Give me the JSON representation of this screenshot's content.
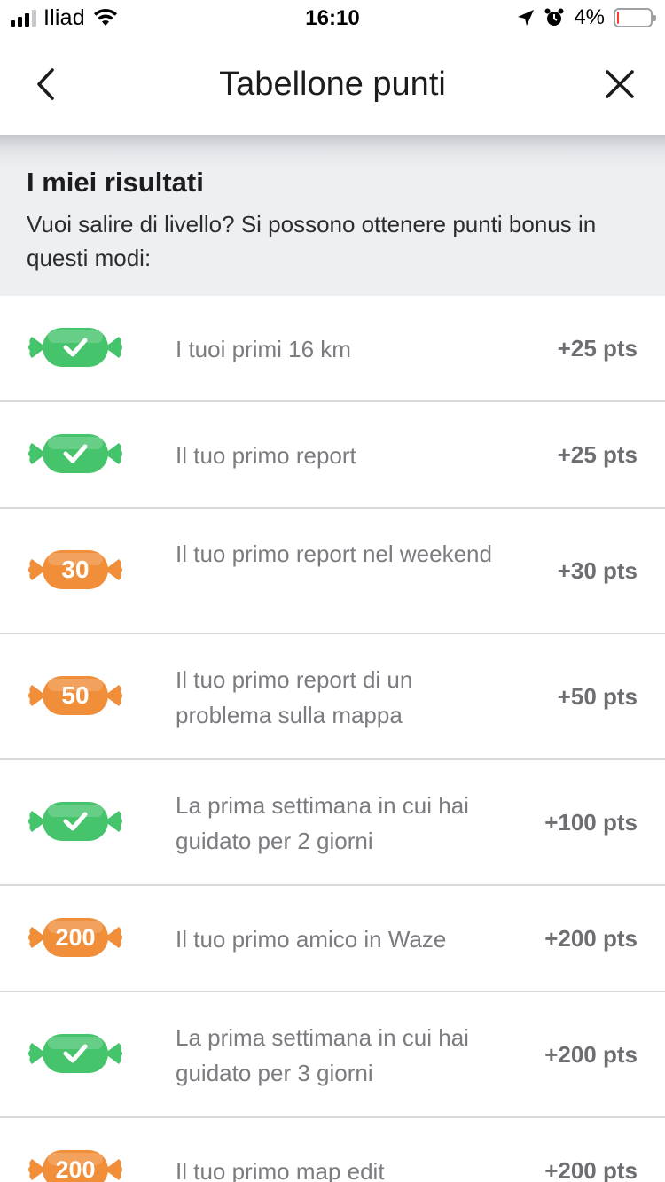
{
  "status_bar": {
    "carrier": "Iliad",
    "time": "16:10",
    "battery": "4%",
    "battery_level": 0.04,
    "icons": [
      "signal-icon",
      "wifi-icon",
      "location-arrow-icon",
      "alarm-icon",
      "battery-icon"
    ]
  },
  "nav": {
    "title": "Tabellone punti",
    "back_icon": "chevron-left-icon",
    "close_icon": "close-icon"
  },
  "header": {
    "title": "I miei risultati",
    "subtitle": "Vuoi salire di livello? Si possono ottenere punti bonus in questi modi:"
  },
  "colors": {
    "green_badge": "#45c46c",
    "orange_badge": "#f08e3a",
    "points_text": "#6d6d72",
    "label_text": "#7b7b80"
  },
  "rows": [
    {
      "badge_type": "check",
      "badge_text": "",
      "label": "I tuoi primi 16 km",
      "points": "+25 pts"
    },
    {
      "badge_type": "check",
      "badge_text": "",
      "label": "Il tuo primo report",
      "points": "+25 pts"
    },
    {
      "badge_type": "number",
      "badge_text": "30",
      "label": "Il tuo primo report nel weekend",
      "points": "+30 pts"
    },
    {
      "badge_type": "number",
      "badge_text": "50",
      "label": "Il tuo primo report di un problema sulla mappa",
      "points": "+50 pts"
    },
    {
      "badge_type": "check",
      "badge_text": "",
      "label": "La prima settimana in cui hai guidato per 2 giorni",
      "points": "+100 pts"
    },
    {
      "badge_type": "number",
      "badge_text": "200",
      "label": "Il tuo primo amico in Waze",
      "points": "+200 pts"
    },
    {
      "badge_type": "check",
      "badge_text": "",
      "label": "La prima settimana in cui hai guidato per 3 giorni",
      "points": "+200 pts"
    },
    {
      "badge_type": "number",
      "badge_text": "200",
      "label": "Il tuo primo map edit",
      "points": "+200 pts"
    }
  ]
}
